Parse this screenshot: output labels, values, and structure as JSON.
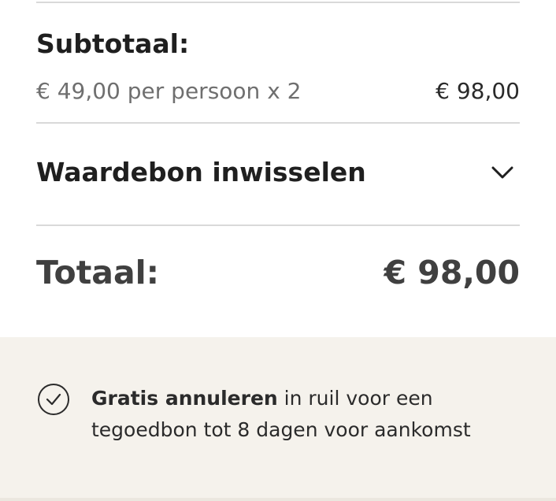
{
  "summary": {
    "subtotal_label": "Subtotaal:",
    "per_person_text": "€ 49,00 per persoon x 2",
    "subtotal_amount": "€ 98,00",
    "voucher_label": "Waardebon inwisselen",
    "total_label": "Totaal:",
    "total_amount": "€ 98,00"
  },
  "notice": {
    "bold_text": "Gratis annuleren",
    "rest_text_line1": " in ruil voor een",
    "rest_text_line2": "tegoedbon tot 8 dagen voor aankomst",
    "icon": "check-circle-icon"
  },
  "colors": {
    "notice_background": "#f5f2ec",
    "divider": "#d9d9d9",
    "text_primary": "#1f1f1f",
    "text_muted": "#6f6f6f",
    "total_text": "#404040"
  }
}
